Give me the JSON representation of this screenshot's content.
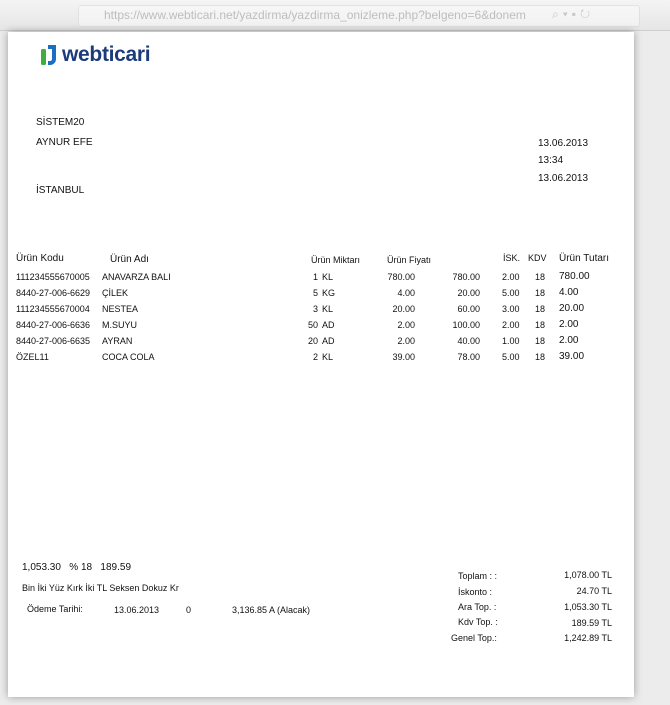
{
  "browser": {
    "url": "https://www.webticari.net/yazdirma/yazdirma_onizleme.php?belgeno=6&donem"
  },
  "logo": {
    "text": "webticari",
    "colors": {
      "green": "#3fae3f",
      "blue": "#1b6ec2",
      "navy": "#1b3b7a"
    }
  },
  "customer": {
    "code": "SİSTEM20",
    "name": "AYNUR EFE",
    "city": "İSTANBUL"
  },
  "document": {
    "date": "13.06.2013",
    "time": "13:34",
    "delivery_date": "13.06.2013"
  },
  "table": {
    "headers": {
      "code": "Ürün Kodu",
      "name": "Ürün Adı",
      "qty": "Ürün Miktarı",
      "price": "Ürün Fiyatı",
      "disc": "İSK.",
      "vat": "KDV",
      "total": "Ürün Tutarı"
    },
    "rows": [
      {
        "code": "111234555670005",
        "name": "ANAVARZA BALI",
        "qty": "1",
        "unit": "KL",
        "price": "780.00",
        "amount": "780.00",
        "disc": "2.00",
        "vat": "18",
        "total": "780.00"
      },
      {
        "code": "8440-27-006-6629",
        "name": "ÇİLEK",
        "qty": "5",
        "unit": "KG",
        "price": "4.00",
        "amount": "20.00",
        "disc": "5.00",
        "vat": "18",
        "total": "4.00"
      },
      {
        "code": "111234555670004",
        "name": "NESTEA",
        "qty": "3",
        "unit": "KL",
        "price": "20.00",
        "amount": "60.00",
        "disc": "3.00",
        "vat": "18",
        "total": "20.00"
      },
      {
        "code": "8440-27-006-6636",
        "name": "M.SUYU",
        "qty": "50",
        "unit": "AD",
        "price": "2.00",
        "amount": "100.00",
        "disc": "2.00",
        "vat": "18",
        "total": "2.00"
      },
      {
        "code": "8440-27-006-6635",
        "name": "AYRAN",
        "qty": "20",
        "unit": "AD",
        "price": "2.00",
        "amount": "40.00",
        "disc": "1.00",
        "vat": "18",
        "total": "2.00"
      },
      {
        "code": "ÖZEL11",
        "name": "COCA COLA",
        "qty": "2",
        "unit": "KL",
        "price": "39.00",
        "amount": "78.00",
        "disc": "5.00",
        "vat": "18",
        "total": "39.00"
      }
    ]
  },
  "vat_summary": {
    "base": "1,053.30",
    "rate": "% 18",
    "amount": "189.59"
  },
  "amount_in_words": "Bin İki Yüz Kırk İki TL Seksen Dokuz Kr",
  "payment": {
    "label": "Ödeme Tarihi:",
    "date": "13.06.2013",
    "days": "0",
    "balance": "3,136.85 A (Alacak)"
  },
  "totals": [
    {
      "label": "Toplam : :",
      "value": "1,078.00 TL"
    },
    {
      "label": "İskonto :",
      "value": "24.70 TL"
    },
    {
      "label": "Ara Top. :",
      "value": "1,053.30 TL"
    },
    {
      "label": "Kdv Top. :",
      "value": "189.59 TL"
    },
    {
      "label": "Genel Top.:",
      "value": "1,242.89 TL"
    }
  ]
}
